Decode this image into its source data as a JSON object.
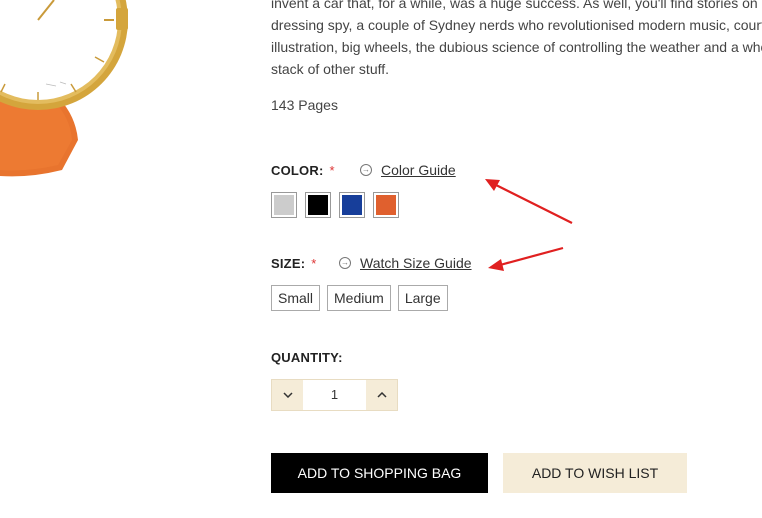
{
  "description": {
    "lines": [
      "invent a car that, for a while, was a huge success. As well, you'll find stories on a",
      "dressing spy, a couple of Sydney nerds who revolutionised modern music, court",
      "illustration, big wheels, the dubious science of controlling the weather and a who",
      "stack of other stuff."
    ]
  },
  "pages_text": "143 Pages",
  "color": {
    "label": "COLOR:",
    "required": "*",
    "guide_label": "Color Guide",
    "swatches": [
      "#cccccc",
      "#000000",
      "#173e9a",
      "#e0602e"
    ]
  },
  "size": {
    "label": "SIZE:",
    "required": "*",
    "guide_label": "Watch Size Guide",
    "options": [
      "Small",
      "Medium",
      "Large"
    ]
  },
  "quantity": {
    "label": "QUANTITY:",
    "value": "1"
  },
  "buttons": {
    "add_to_bag": "ADD TO SHOPPING BAG",
    "add_to_wishlist": "ADD TO WISH LIST"
  },
  "colors": {
    "accent_beige": "#f5ecd8",
    "annotation_red": "#e02020",
    "strap_orange": "#e8742e",
    "case_gold": "#d4a53c"
  }
}
